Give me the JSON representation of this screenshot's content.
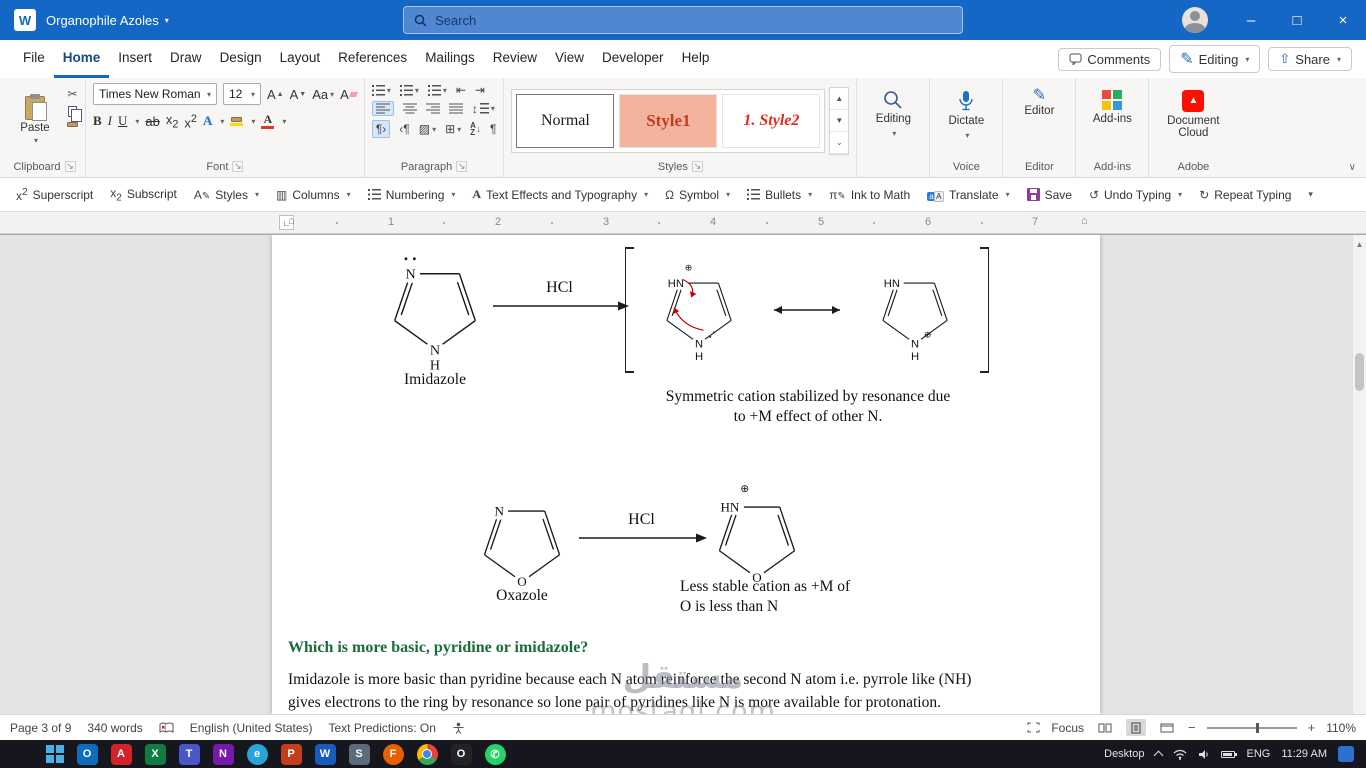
{
  "titlebar": {
    "doc_title": "Organophile Azoles",
    "search_placeholder": "Search",
    "window_controls": {
      "minimize": "–",
      "maximize": "□",
      "close": "×"
    }
  },
  "menubar": {
    "tabs": [
      "File",
      "Home",
      "Insert",
      "Draw",
      "Design",
      "Layout",
      "References",
      "Mailings",
      "Review",
      "View",
      "Developer",
      "Help"
    ],
    "active_tab": "Home",
    "comments_label": "Comments",
    "editing_label": "Editing",
    "share_label": "Share"
  },
  "ribbon": {
    "paste_label": "Paste",
    "font_name": "Times New Roman",
    "font_size": "12",
    "styles_gallery": [
      "Normal",
      "Style1",
      "1. Style2"
    ],
    "editing_button": "Editing",
    "dictate_label": "Dictate",
    "editor_label": "Editor",
    "addins_label": "Add-ins",
    "doccloud_label": "Document Cloud",
    "group_labels": {
      "clipboard": "Clipboard",
      "font": "Font",
      "paragraph": "Paragraph",
      "styles": "Styles",
      "voice": "Voice",
      "editor": "Editor",
      "addins": "Add-ins",
      "adobe": "Adobe"
    }
  },
  "quickbar": {
    "superscript": "Superscript",
    "subscript": "Subscript",
    "styles": "Styles",
    "columns": "Columns",
    "numbering": "Numbering",
    "text_effects": "Text Effects and Typography",
    "symbol": "Symbol",
    "bullets": "Bullets",
    "ink_to_math": "Ink to Math",
    "translate": "Translate",
    "save": "Save",
    "undo": "Undo Typing",
    "repeat": "Repeat Typing"
  },
  "ruler": {
    "numbers": [
      "1",
      "2",
      "3",
      "4",
      "5",
      "6",
      "7"
    ]
  },
  "document": {
    "molecule1_name": "Imidazole",
    "reagent1": "HCl",
    "caption1_line1": "Symmetric cation stabilized by resonance due",
    "caption1_line2": "to +M effect of other N.",
    "molecule2_name": "Oxazole",
    "reagent2": "HCl",
    "caption2_line1": "Less stable cation as +M of",
    "caption2_line2": "O is less than N",
    "heading": "Which is more basic, pyridine or imidazole?",
    "body_line1": "Imidazole is more basic than pyridine because each N atom reinforce the second N atom i.e. pyrrole like (NH)",
    "body_line2": "gives electrons to the ring by resonance so lone pair of pyridines like N is more available for protonation.",
    "atoms": {
      "N": "N",
      "H": "H",
      "HN": "HN",
      "O": "O",
      "plus": "⊕"
    },
    "watermark_line1": "مستقل",
    "watermark_line2": "mostaql.com"
  },
  "statusbar": {
    "page": "Page 3 of 9",
    "words": "340 words",
    "language": "English (United States)",
    "predictions": "Text Predictions: On",
    "focus": "Focus",
    "zoom": "110%"
  },
  "taskbar": {
    "desktop_label": "Desktop",
    "lang": "ENG",
    "time": "11:29 AM",
    "apps": [
      {
        "name": "outlook",
        "glyph": "O",
        "bg": "#0f6cbd"
      },
      {
        "name": "acrobat",
        "glyph": "A",
        "bg": "#d3222a"
      },
      {
        "name": "excel",
        "glyph": "X",
        "bg": "#107c41"
      },
      {
        "name": "teams",
        "glyph": "T",
        "bg": "#4a57c9"
      },
      {
        "name": "onenote",
        "glyph": "N",
        "bg": "#7719aa"
      },
      {
        "name": "edge",
        "glyph": "e",
        "bg": "#2aa3d8"
      },
      {
        "name": "powerpoint",
        "glyph": "P",
        "bg": "#c43e1c"
      },
      {
        "name": "word",
        "glyph": "W",
        "bg": "#185abd"
      },
      {
        "name": "steam",
        "glyph": "S",
        "bg": "#5c6b7a"
      },
      {
        "name": "firefox",
        "glyph": "F",
        "bg": "#e66000"
      },
      {
        "name": "chrome",
        "glyph": "",
        "bg": ""
      },
      {
        "name": "opera",
        "glyph": "O",
        "bg": "#232323"
      },
      {
        "name": "whatsapp",
        "glyph": "✆",
        "bg": "#25d366"
      }
    ]
  }
}
